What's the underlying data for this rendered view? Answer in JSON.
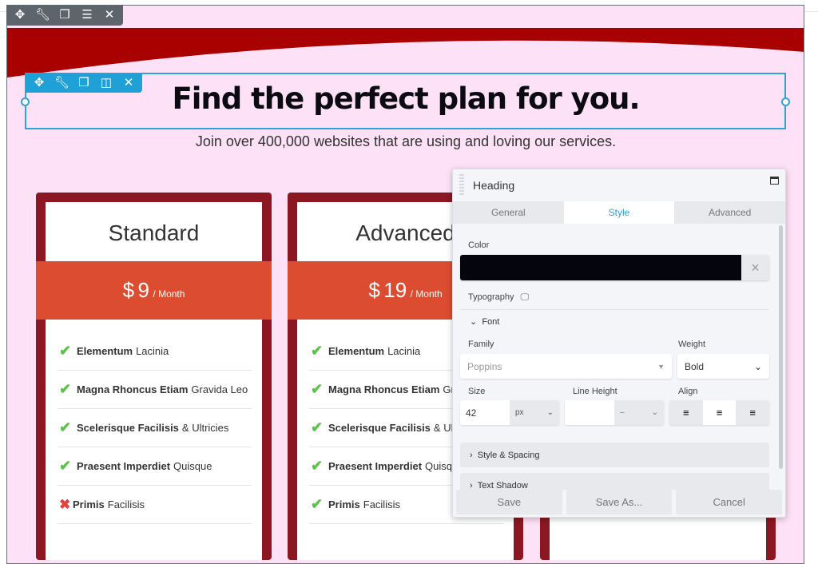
{
  "row_toolbar": {
    "icons": [
      "move-icon",
      "wrench-icon",
      "copy-icon",
      "menu-icon",
      "close-icon"
    ]
  },
  "module_toolbar": {
    "icons": [
      "move-icon",
      "wrench-icon",
      "copy-icon",
      "columns-icon",
      "close-icon"
    ]
  },
  "colors": {
    "band": "#a90000",
    "background": "#fde1f7",
    "card": "#8a1722",
    "price": "#dc4c30",
    "accent": "#2aa4dc"
  },
  "page": {
    "heading": "Find the perfect plan for you.",
    "subheading": "Join over 400,000 websites that are using and loving our services."
  },
  "cards": [
    {
      "title": "Standard",
      "currency": "$",
      "amount": "9",
      "period": "/ Month",
      "features": [
        {
          "ok": true,
          "bold": "Elementum",
          "rest": "Lacinia"
        },
        {
          "ok": true,
          "bold": "Magna Rhoncus Etiam",
          "rest": "Gravida Leo"
        },
        {
          "ok": true,
          "bold": "Scelerisque Facilisis",
          "rest": "& Ultricies"
        },
        {
          "ok": true,
          "bold": "Praesent Imperdiet",
          "rest": "Quisque"
        },
        {
          "ok": false,
          "bold": "Primis",
          "rest": "Facilisis"
        }
      ]
    },
    {
      "title": "Advanced",
      "currency": "$",
      "amount": "19",
      "period": "/ Month",
      "features": [
        {
          "ok": true,
          "bold": "Elementum",
          "rest": "Lacinia"
        },
        {
          "ok": true,
          "bold": "Magna Rhoncus Etiam",
          "rest": "Gravida Leo"
        },
        {
          "ok": true,
          "bold": "Scelerisque Facilisis",
          "rest": "& Ultricies"
        },
        {
          "ok": true,
          "bold": "Praesent Imperdiet",
          "rest": "Quisque"
        },
        {
          "ok": true,
          "bold": "Primis",
          "rest": "Facilisis"
        }
      ]
    }
  ],
  "panel": {
    "title": "Heading",
    "tabs": [
      "General",
      "Style",
      "Advanced"
    ],
    "active_tab": "Style",
    "color_label": "Color",
    "color_value": "#05050d",
    "typography_label": "Typography",
    "font_section": "Font",
    "family_label": "Family",
    "family_value": "Poppins",
    "weight_label": "Weight",
    "weight_value": "Bold",
    "size_label": "Size",
    "size_value": "42",
    "size_unit": "px",
    "line_height_label": "Line Height",
    "line_height_value": "",
    "line_height_unit": "–",
    "align_label": "Align",
    "align_value": "center",
    "style_spacing": "Style & Spacing",
    "text_shadow": "Text Shadow",
    "save": "Save",
    "save_as": "Save As...",
    "cancel": "Cancel"
  }
}
